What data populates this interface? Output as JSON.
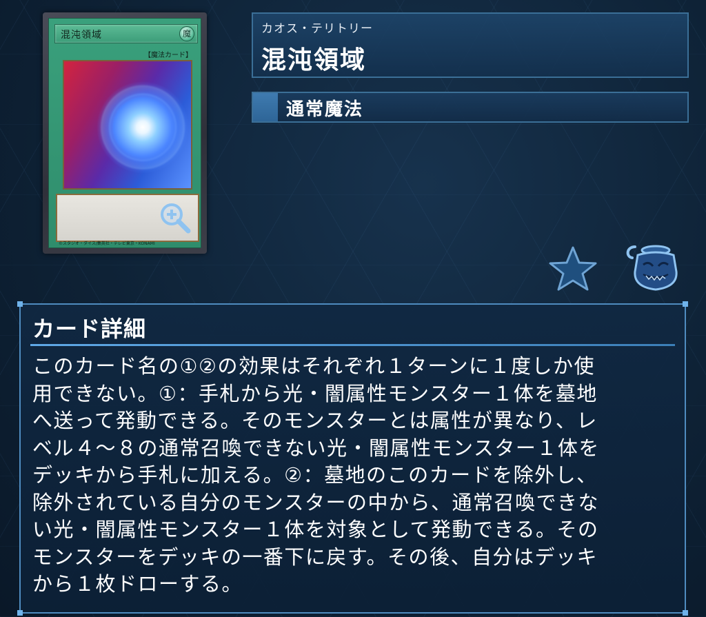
{
  "card": {
    "name_on_card": "混沌領域",
    "attribute_glyph": "魔",
    "type_line": "【魔法カード】",
    "copyright": "©スタジオ・ダイス/集英社・テレビ東京・KONAMI",
    "zoom_icon": "zoom-in-icon"
  },
  "header": {
    "reading": "カオス・テリトリー",
    "title": "混沌領域",
    "type": "通常魔法"
  },
  "actions": {
    "favorite_icon": "star-icon",
    "pot_icon": "pot-of-greed-icon"
  },
  "detail": {
    "heading": "カード詳細",
    "text": "このカード名の①②の効果はそれぞれ１ターンに１度しか使\n用できない。①：手札から光・闇属性モンスター１体を墓地\nへ送って発動できる。そのモンスターとは属性が異なり、レ\nベル４～８の通常召喚できない光・闇属性モンスター１体を\nデッキから手札に加える。②：墓地のこのカードを除外し、\n除外されている自分のモンスターの中から、通常召喚できな\nい光・闇属性モンスター１体を対象として発動できる。その\nモンスターをデッキの一番下に戻す。その後、自分はデッキ\nから１枚ドローする。"
  },
  "colors": {
    "panel_border": "#3b6f97",
    "detail_border": "#4f8cc0",
    "spell_green": "#3aa07c"
  }
}
